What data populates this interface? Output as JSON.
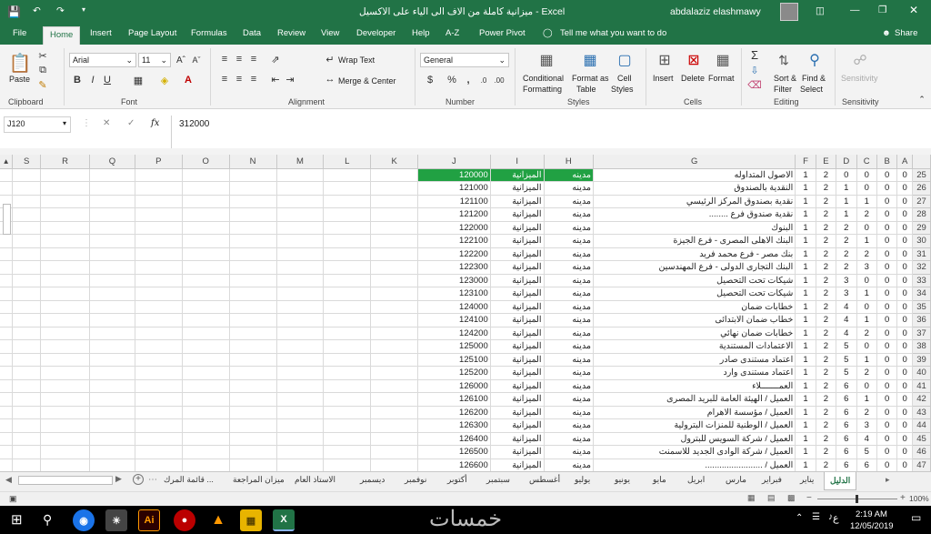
{
  "window": {
    "title": "ميزانية كاملة من الاف الى الياء على الاكسيل - Excel",
    "user": "abdalaziz elashmawy"
  },
  "ribbon_tabs": [
    "File",
    "Home",
    "Insert",
    "Page Layout",
    "Formulas",
    "Data",
    "Review",
    "View",
    "Developer",
    "Help",
    "A-Z",
    "Power Pivot"
  ],
  "tell_me": "Tell me what you want to do",
  "share": "Share",
  "ribbon": {
    "paste": "Paste",
    "clipboard": "Clipboard",
    "font_name": "Arial",
    "font_size": "11",
    "font": "Font",
    "wrap_text": "Wrap Text",
    "merge_center": "Merge & Center",
    "alignment": "Alignment",
    "number_format": "General",
    "number": "Number",
    "conditional_formatting": [
      "Conditional",
      "Formatting"
    ],
    "format_as_table": [
      "Format as",
      "Table"
    ],
    "cell_styles": [
      "Cell",
      "Styles"
    ],
    "styles": "Styles",
    "insert": "Insert",
    "delete": "Delete",
    "format": "Format",
    "cells": "Cells",
    "sort_filter": [
      "Sort &",
      "Filter"
    ],
    "find_select": [
      "Find &",
      "Select"
    ],
    "editing": "Editing",
    "sensitivity": "Sensitivity"
  },
  "formula_bar": {
    "name_box": "J120",
    "fx": "fx",
    "value": "312000"
  },
  "columns": [
    "S",
    "R",
    "Q",
    "P",
    "O",
    "N",
    "M",
    "L",
    "K",
    "J",
    "I",
    "H",
    "G",
    "F",
    "E",
    "D",
    "C",
    "B",
    "A"
  ],
  "rows": [
    {
      "n": "25",
      "J": "120000",
      "I": "الميزانية",
      "H": "مدينه",
      "G": "الاصول المتداوله",
      "F": "1",
      "E": "2",
      "D": "0",
      "C": "0",
      "B": "0",
      "A": "0"
    },
    {
      "n": "26",
      "J": "121000",
      "I": "الميزانية",
      "H": "مدينه",
      "G": "النقدية بالصندوق",
      "F": "1",
      "E": "2",
      "D": "1",
      "C": "0",
      "B": "0",
      "A": "0"
    },
    {
      "n": "27",
      "J": "121100",
      "I": "الميزانية",
      "H": "مدينه",
      "G": "نقدية بصندوق المركز الرئيسي",
      "F": "1",
      "E": "2",
      "D": "1",
      "C": "1",
      "B": "0",
      "A": "0"
    },
    {
      "n": "28",
      "J": "121200",
      "I": "الميزانية",
      "H": "مدينه",
      "G": "نقدية صندوق فرع ........",
      "F": "1",
      "E": "2",
      "D": "1",
      "C": "2",
      "B": "0",
      "A": "0"
    },
    {
      "n": "29",
      "J": "122000",
      "I": "الميزانية",
      "H": "مدينه",
      "G": "البنوك",
      "F": "1",
      "E": "2",
      "D": "2",
      "C": "0",
      "B": "0",
      "A": "0"
    },
    {
      "n": "30",
      "J": "122100",
      "I": "الميزانية",
      "H": "مدينه",
      "G": "البنك الاهلى المصرى - فرع الجيزة",
      "F": "1",
      "E": "2",
      "D": "2",
      "C": "1",
      "B": "0",
      "A": "0"
    },
    {
      "n": "31",
      "J": "122200",
      "I": "الميزانية",
      "H": "مدينه",
      "G": "بنك مصر - فرع محمد فريد",
      "F": "1",
      "E": "2",
      "D": "2",
      "C": "2",
      "B": "0",
      "A": "0"
    },
    {
      "n": "32",
      "J": "122300",
      "I": "الميزانية",
      "H": "مدينه",
      "G": "البنك التجارى الدولى - فرع المهندسين",
      "F": "1",
      "E": "2",
      "D": "2",
      "C": "3",
      "B": "0",
      "A": "0"
    },
    {
      "n": "33",
      "J": "123000",
      "I": "الميزانية",
      "H": "مدينه",
      "G": "شيكات تحت التحصيل",
      "F": "1",
      "E": "2",
      "D": "3",
      "C": "0",
      "B": "0",
      "A": "0"
    },
    {
      "n": "34",
      "J": "123100",
      "I": "الميزانية",
      "H": "مدينه",
      "G": "شيكات تحت التحصيل",
      "F": "1",
      "E": "2",
      "D": "3",
      "C": "1",
      "B": "0",
      "A": "0"
    },
    {
      "n": "35",
      "J": "124000",
      "I": "الميزانية",
      "H": "مدينه",
      "G": "خطابات ضمان",
      "F": "1",
      "E": "2",
      "D": "4",
      "C": "0",
      "B": "0",
      "A": "0"
    },
    {
      "n": "36",
      "J": "124100",
      "I": "الميزانية",
      "H": "مدينه",
      "G": "خطاب ضمان الابتدائى",
      "F": "1",
      "E": "2",
      "D": "4",
      "C": "1",
      "B": "0",
      "A": "0"
    },
    {
      "n": "37",
      "J": "124200",
      "I": "الميزانية",
      "H": "مدينه",
      "G": "خطابات ضمان نهائي",
      "F": "1",
      "E": "2",
      "D": "4",
      "C": "2",
      "B": "0",
      "A": "0"
    },
    {
      "n": "38",
      "J": "125000",
      "I": "الميزانية",
      "H": "مدينه",
      "G": "الاعتمادات المستندية",
      "F": "1",
      "E": "2",
      "D": "5",
      "C": "0",
      "B": "0",
      "A": "0"
    },
    {
      "n": "39",
      "J": "125100",
      "I": "الميزانية",
      "H": "مدينه",
      "G": "اعتماد مستندى صادر",
      "F": "1",
      "E": "2",
      "D": "5",
      "C": "1",
      "B": "0",
      "A": "0"
    },
    {
      "n": "40",
      "J": "125200",
      "I": "الميزانية",
      "H": "مدينه",
      "G": "اعتماد مستندى وارد",
      "F": "1",
      "E": "2",
      "D": "5",
      "C": "2",
      "B": "0",
      "A": "0"
    },
    {
      "n": "41",
      "J": "126000",
      "I": "الميزانية",
      "H": "مدينه",
      "G": "العمـــــــلاء",
      "F": "1",
      "E": "2",
      "D": "6",
      "C": "0",
      "B": "0",
      "A": "0"
    },
    {
      "n": "42",
      "J": "126100",
      "I": "الميزانية",
      "H": "مدينه",
      "G": "العميل / الهيئة العامة للبريد المصرى",
      "F": "1",
      "E": "2",
      "D": "6",
      "C": "1",
      "B": "0",
      "A": "0"
    },
    {
      "n": "43",
      "J": "126200",
      "I": "الميزانية",
      "H": "مدينه",
      "G": "العميل / مؤسسة الاهرام",
      "F": "1",
      "E": "2",
      "D": "6",
      "C": "2",
      "B": "0",
      "A": "0"
    },
    {
      "n": "44",
      "J": "126300",
      "I": "الميزانية",
      "H": "مدينه",
      "G": "العميل / الوطنية للمنزات البترولية",
      "F": "1",
      "E": "2",
      "D": "6",
      "C": "3",
      "B": "0",
      "A": "0"
    },
    {
      "n": "45",
      "J": "126400",
      "I": "الميزانية",
      "H": "مدينه",
      "G": "العميل / شركة السويس للبترول",
      "F": "1",
      "E": "2",
      "D": "6",
      "C": "4",
      "B": "0",
      "A": "0"
    },
    {
      "n": "46",
      "J": "126500",
      "I": "الميزانية",
      "H": "مدينه",
      "G": "العميل / شركة الوادى الجديد للاسمنت",
      "F": "1",
      "E": "2",
      "D": "6",
      "C": "5",
      "B": "0",
      "A": "0"
    },
    {
      "n": "47",
      "J": "126600",
      "I": "الميزانية",
      "H": "مدينه",
      "G": "العميل / ........................",
      "F": "1",
      "E": "2",
      "D": "6",
      "C": "6",
      "B": "0",
      "A": "0"
    }
  ],
  "sheet_tabs": [
    "الدليل",
    "يناير",
    "فبراير",
    "مارس",
    "ابريل",
    "مايو",
    "يونيو",
    "يوليو",
    "أغسطس",
    "سبتمبر",
    "أكتوبر",
    "نوفمبر",
    "ديسمبر",
    "الاستاذ العام",
    "ميزان المراجعة",
    "قائمة المرك ..."
  ],
  "status": {
    "zoom": "100%"
  },
  "taskbar": {
    "lang": "ع",
    "time": "2:19 AM",
    "date": "12/05/2019",
    "watermark": "خمسات"
  }
}
